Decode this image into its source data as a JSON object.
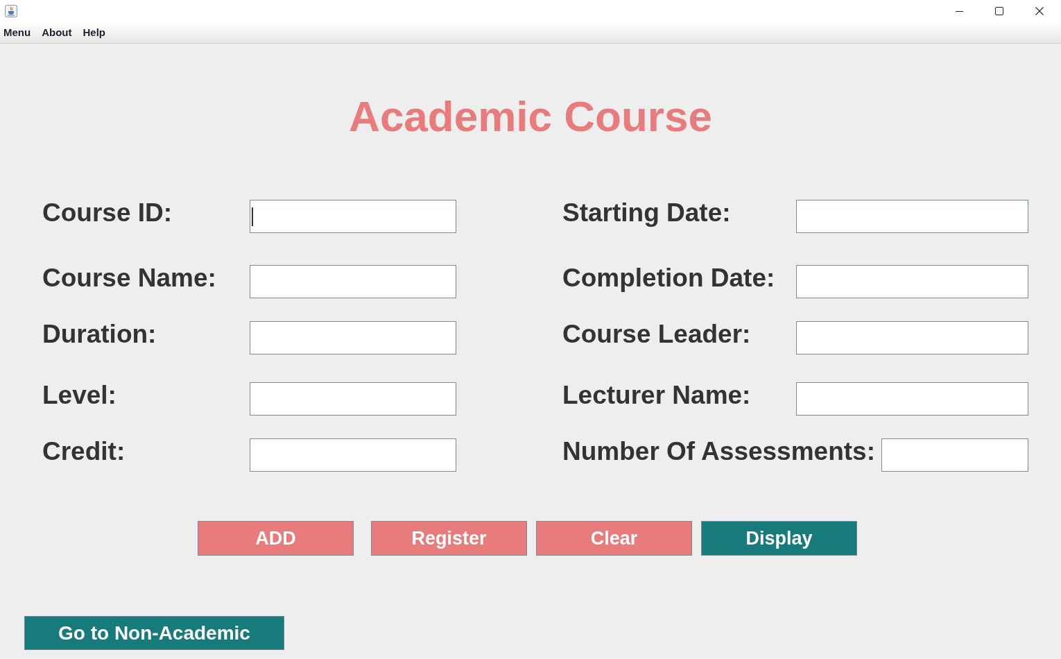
{
  "menu_bar": {
    "items": [
      "Menu",
      "About",
      "Help"
    ]
  },
  "heading": "Academic Course",
  "form": {
    "rows": [
      {
        "fields": [
          {
            "label": "Course ID:",
            "focused": true
          },
          {
            "label": "Starting Date:",
            "focused": false
          }
        ]
      },
      {
        "fields": [
          {
            "label": "Course Name:",
            "focused": false
          },
          {
            "label": "Completion Date:",
            "focused": false
          }
        ]
      },
      {
        "fields": [
          {
            "label": "Duration:",
            "focused": false
          },
          {
            "label": "Course Leader:",
            "focused": false
          }
        ]
      },
      {
        "fields": [
          {
            "label": "Level:",
            "focused": false
          },
          {
            "label": "Lecturer Name:",
            "focused": false
          }
        ]
      },
      {
        "fields": [
          {
            "label": "Credit:",
            "focused": false
          },
          {
            "label": "Number Of Assessments:",
            "focused": false
          }
        ]
      }
    ]
  },
  "actions": [
    {
      "label": "ADD",
      "color": "#e87c7c"
    },
    {
      "label": "Register",
      "color": "#e87c7c"
    },
    {
      "label": "Clear",
      "color": "#e87c7c"
    },
    {
      "label": "Display",
      "color": "#187b7b"
    }
  ],
  "navigation_button": {
    "label": "Go to Non-Academic"
  }
}
